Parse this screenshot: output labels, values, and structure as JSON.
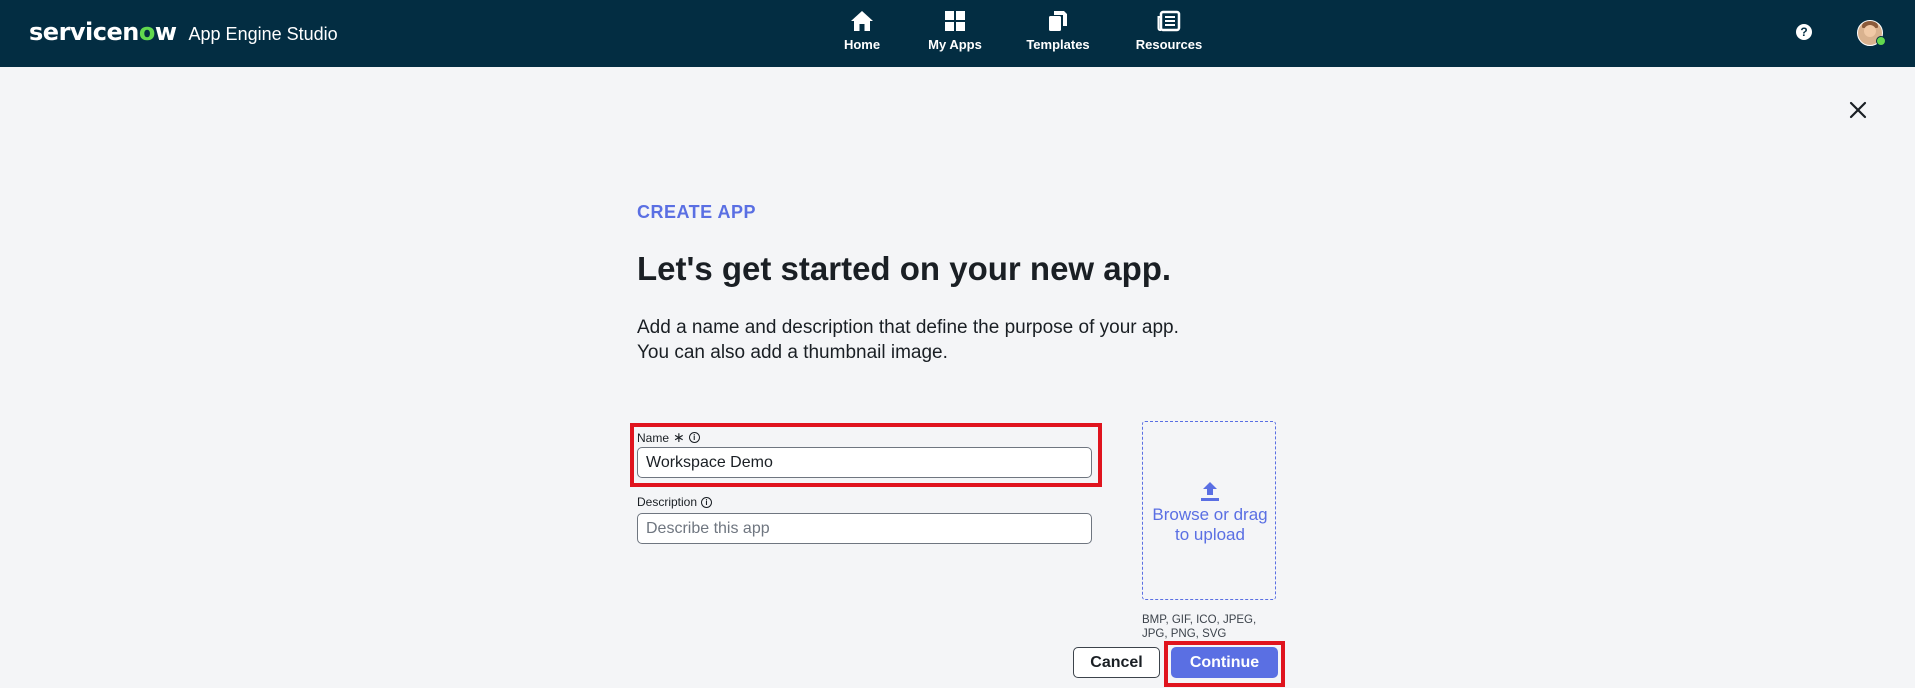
{
  "header": {
    "brand_logo_pre": "servicen",
    "brand_logo_o": "o",
    "brand_logo_post": "w",
    "app_name": "App Engine Studio",
    "nav": [
      {
        "label": "Home",
        "icon": "home-icon"
      },
      {
        "label": "My Apps",
        "icon": "grid-icon"
      },
      {
        "label": "Templates",
        "icon": "copy-icon"
      },
      {
        "label": "Resources",
        "icon": "newspaper-icon"
      }
    ],
    "help_glyph": "?",
    "help_icon": "help-icon",
    "avatar_icon": "user-avatar"
  },
  "dialog": {
    "eyebrow": "CREATE APP",
    "title": "Let's get started on your new app.",
    "subtitle_line1": "Add a name and description that define the purpose of your app.",
    "subtitle_line2": "You can also add a thumbnail image.",
    "name_field": {
      "label": "Name",
      "required_mark": "∗",
      "value": "Workspace Demo"
    },
    "description_field": {
      "label": "Description",
      "placeholder": "Describe this app",
      "value": ""
    },
    "upload": {
      "line1": "Browse or drag",
      "line2": "to upload",
      "formats_line1": "BMP, GIF, ICO, JPEG,",
      "formats_line2": "JPG, PNG, SVG"
    },
    "cancel_label": "Cancel",
    "continue_label": "Continue"
  },
  "colors": {
    "header_bg": "#032d42",
    "accent": "#5a6fe3",
    "highlight": "#e0141e",
    "page_bg": "#f4f5f7"
  }
}
